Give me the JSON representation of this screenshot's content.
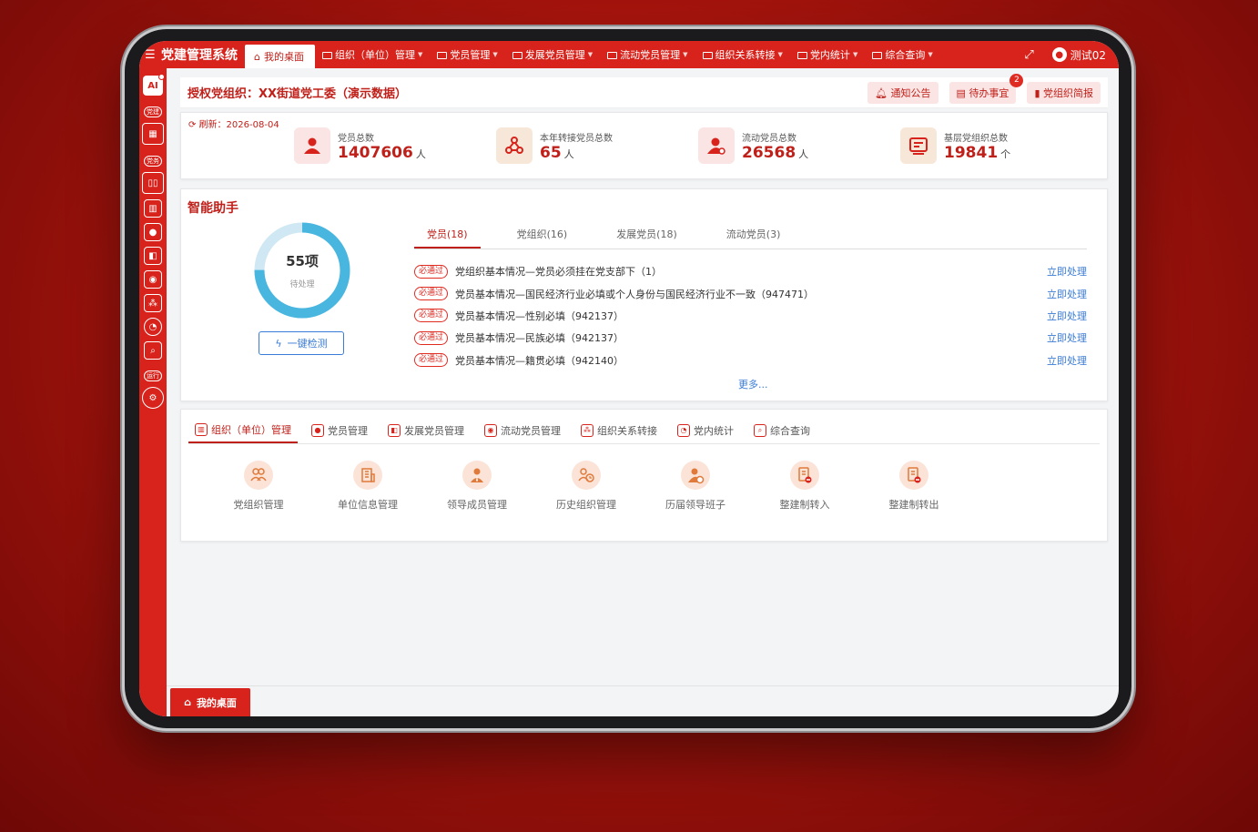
{
  "header": {
    "app_title": "党建管理系统",
    "home_tab": "我的桌面",
    "nav": [
      "组织（单位）管理",
      "党员管理",
      "发展党员管理",
      "流动党员管理",
      "组织关系转接",
      "党内统计",
      "综合查询"
    ],
    "user": "测试02"
  },
  "sidebar": {
    "ai_label": "AI",
    "section_1": "党建",
    "section_2": "党务",
    "section_3": "运行"
  },
  "org_bar": {
    "title": "授权党组织：XX街道党工委（演示数据）",
    "notice": "通知公告",
    "todo": "待办事宜",
    "todo_badge": "2",
    "report": "党组织简报"
  },
  "stats": {
    "refresh": "刷新：2026-08-04",
    "items": [
      {
        "label": "党员总数",
        "value": "1407606",
        "unit": "人"
      },
      {
        "label": "本年转接党员总数",
        "value": "65",
        "unit": "人"
      },
      {
        "label": "流动党员总数",
        "value": "26568",
        "unit": "人"
      },
      {
        "label": "基层党组织总数",
        "value": "19841",
        "unit": "个"
      }
    ]
  },
  "assistant": {
    "title": "智能助手",
    "count": "55项",
    "pending": "待处理",
    "progress": 0.75,
    "check_button": "一键检测",
    "tabs": [
      "党员(18)",
      "党组织(16)",
      "发展党员(18)",
      "流动党员(3)"
    ],
    "issues": [
      {
        "tag": "必通过",
        "text": "党组织基本情况—党员必须挂在党支部下（1）",
        "action": "立即处理"
      },
      {
        "tag": "必通过",
        "text": "党员基本情况—国民经济行业必填或个人身份与国民经济行业不一致（947471）",
        "action": "立即处理"
      },
      {
        "tag": "必通过",
        "text": "党员基本情况—性别必填（942137）",
        "action": "立即处理"
      },
      {
        "tag": "必通过",
        "text": "党员基本情况—民族必填（942137）",
        "action": "立即处理"
      },
      {
        "tag": "必通过",
        "text": "党员基本情况—籍贯必填（942140）",
        "action": "立即处理"
      }
    ],
    "more": "更多..."
  },
  "modules": {
    "tabs": [
      "组织（单位）管理",
      "党员管理",
      "发展党员管理",
      "流动党员管理",
      "组织关系转接",
      "党内统计",
      "综合查询"
    ],
    "items": [
      "党组织管理",
      "单位信息管理",
      "领导成员管理",
      "历史组织管理",
      "历届领导班子",
      "整建制转入",
      "整建制转出"
    ]
  },
  "footer": {
    "tab": "我的桌面"
  },
  "colors": {
    "brand": "#d7231c",
    "link": "#3a7bd5",
    "ring": "#49b6e0"
  }
}
